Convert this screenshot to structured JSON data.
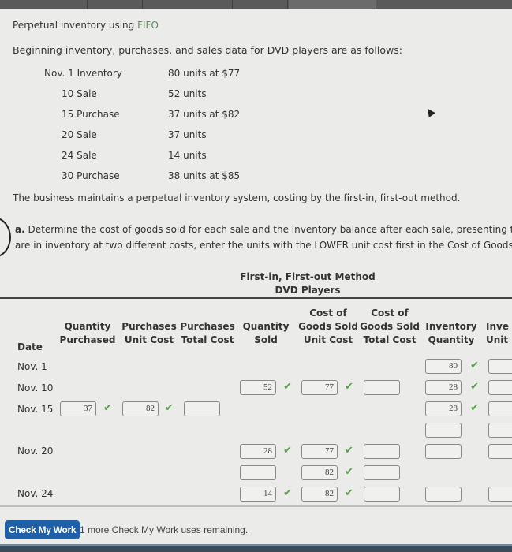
{
  "problem": {
    "title_prefix": "Perpetual inventory using ",
    "title_highlight": "FIFO",
    "intro": "Beginning inventory, purchases, and sales data for DVD players are as follows:",
    "transactions": [
      {
        "date": "Nov. 1",
        "type": "Inventory",
        "detail": "80 units at $77"
      },
      {
        "date": "10",
        "type": "Sale",
        "detail": "52 units"
      },
      {
        "date": "15",
        "type": "Purchase",
        "detail": "37 units at $82"
      },
      {
        "date": "20",
        "type": "Sale",
        "detail": "37 units"
      },
      {
        "date": "24",
        "type": "Sale",
        "detail": "14 units"
      },
      {
        "date": "30",
        "type": "Purchase",
        "detail": "38 units at $85"
      }
    ],
    "description": "The business maintains a perpetual inventory system, costing by the first-in, first-out method.",
    "question_label": "a.",
    "question_line1": "Determine the cost of goods sold for each sale and the inventory balance after each sale, presenting the",
    "question_line2": "are in inventory at two different costs, enter the units with the LOWER unit cost first in the Cost of Goods S"
  },
  "table": {
    "title_line1": "First-in, First-out Method",
    "title_line2": "DVD Players",
    "headers": {
      "date": "Date",
      "qty_purchased": [
        "Quantity",
        "Purchased"
      ],
      "purch_unit_cost": [
        "Purchases",
        "Unit Cost"
      ],
      "purch_total_cost": [
        "Purchases",
        "Total Cost"
      ],
      "qty_sold": [
        "Quantity",
        "Sold"
      ],
      "cogs_unit_cost": [
        "Cost of",
        "Goods Sold",
        "Unit Cost"
      ],
      "cogs_total_cost": [
        "Cost of",
        "Goods Sold",
        "Total Cost"
      ],
      "inv_quantity": [
        "Inventory",
        "Quantity"
      ],
      "inv_unit": [
        "Inve",
        "Unit"
      ]
    },
    "dates": [
      "Nov. 1",
      "Nov. 10",
      "Nov. 15",
      "Nov. 20",
      "Nov. 24"
    ],
    "values": {
      "nov1_inv_qty": "80",
      "nov10_qty_sold": "52",
      "nov10_cogs_unit": "77",
      "nov10_inv_qty": "28",
      "nov15_qty_purchased": "37",
      "nov15_purch_unit": "82",
      "nov15_inv_qty": "28",
      "nov20_qty_sold_1": "28",
      "nov20_cogs_unit_1": "77",
      "nov20_cogs_unit_2": "82",
      "nov24_qty_sold": "14",
      "nov24_cogs_unit": "82"
    },
    "check_mark": "✔"
  },
  "footer": {
    "check_button": "Check My Work",
    "remaining": "1 more Check My Work uses remaining."
  },
  "colors": {
    "accent_blue": "#1f5fa6",
    "check_green": "#5aa04a",
    "fifo_green": "#5f8a5a"
  }
}
